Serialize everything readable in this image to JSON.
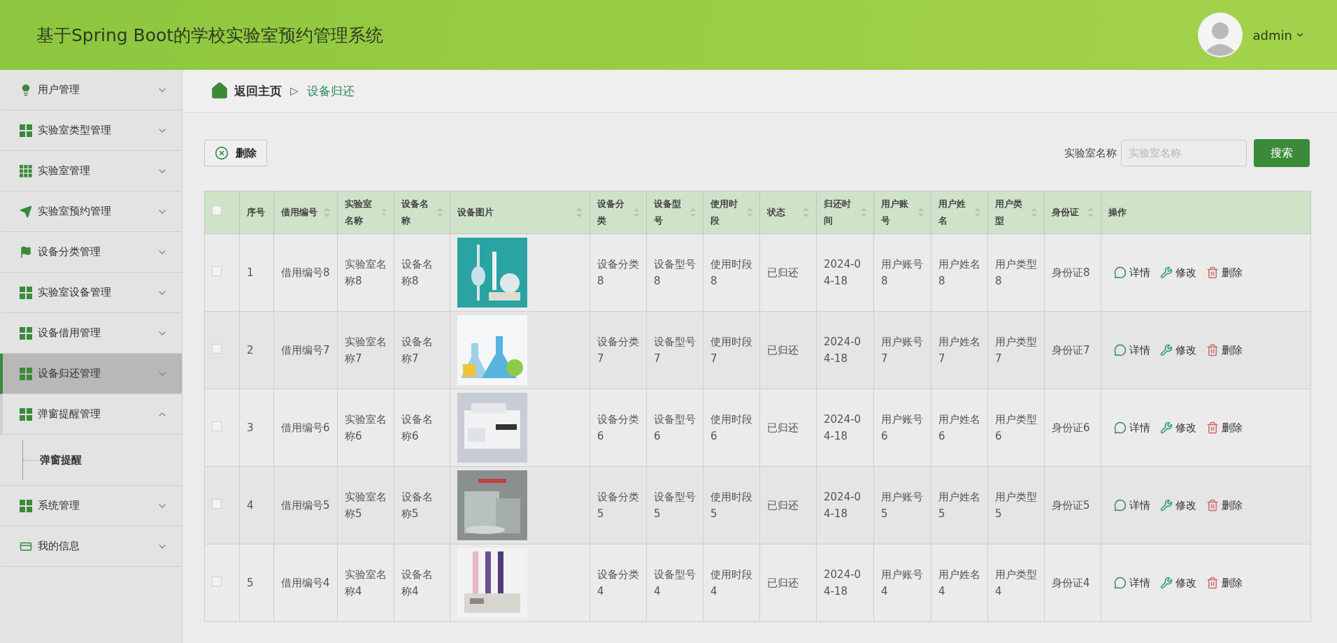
{
  "header": {
    "title": "基于Spring Boot的学校实验室预约管理系统",
    "user": "admin"
  },
  "sidebar": {
    "items": [
      {
        "label": "用户管理",
        "selected": false,
        "expanded": false
      },
      {
        "label": "实验室类型管理",
        "selected": false,
        "expanded": false
      },
      {
        "label": "实验室管理",
        "selected": false,
        "expanded": false
      },
      {
        "label": "实验室预约管理",
        "selected": false,
        "expanded": false
      },
      {
        "label": "设备分类管理",
        "selected": false,
        "expanded": false
      },
      {
        "label": "实验室设备管理",
        "selected": false,
        "expanded": false
      },
      {
        "label": "设备借用管理",
        "selected": false,
        "expanded": false
      },
      {
        "label": "设备归还管理",
        "selected": true,
        "expanded": false
      },
      {
        "label": "弹窗提醒管理",
        "selected": false,
        "expanded": true,
        "children": [
          {
            "label": "弹窗提醒",
            "selected": false
          }
        ]
      },
      {
        "label": "系统管理",
        "selected": false,
        "expanded": false
      },
      {
        "label": "我的信息",
        "selected": false,
        "expanded": false
      }
    ]
  },
  "breadcrumb": {
    "home": "返回主页",
    "separator": "▷",
    "current": "设备归还"
  },
  "toolbar": {
    "delete_button": "删除",
    "search_label": "实验室名称",
    "search_placeholder": "实验室名称",
    "search_button": "搜索"
  },
  "table": {
    "select_all": {
      "checked": false
    },
    "columns": [
      {
        "label": "序号",
        "sortable": false
      },
      {
        "label": "借用编号",
        "sortable": true
      },
      {
        "label": "实验室名称",
        "sortable": true
      },
      {
        "label": "设备名称",
        "sortable": true
      },
      {
        "label": "设备图片",
        "sortable": true
      },
      {
        "label": "设备分类",
        "sortable": true
      },
      {
        "label": "设备型号",
        "sortable": true
      },
      {
        "label": "使用时段",
        "sortable": true
      },
      {
        "label": "状态",
        "sortable": true
      },
      {
        "label": "归还时间",
        "sortable": true
      },
      {
        "label": "用户账号",
        "sortable": true
      },
      {
        "label": "用户姓名",
        "sortable": true
      },
      {
        "label": "用户类型",
        "sortable": true
      },
      {
        "label": "身份证",
        "sortable": true
      },
      {
        "label": "操作",
        "sortable": false
      }
    ],
    "rows": [
      {
        "checked": false,
        "cells": [
          "1",
          "借用编号8",
          "实验室名称8",
          "设备名称8",
          {
            "kind": "picture"
          },
          "设备分类8",
          "设备型号8",
          "使用时段8",
          "已归还",
          "2024-04-18",
          "用户账号8",
          "用户姓名8",
          "用户类型8",
          "身份证8"
        ],
        "actions": [
          "详情",
          "修改",
          "删除"
        ]
      },
      {
        "checked": false,
        "cells": [
          "2",
          "借用编号7",
          "实验室名称7",
          "设备名称7",
          {
            "kind": "picture"
          },
          "设备分类7",
          "设备型号7",
          "使用时段7",
          "已归还",
          "2024-04-18",
          "用户账号7",
          "用户姓名7",
          "用户类型7",
          "身份证7"
        ],
        "actions": [
          "详情",
          "修改",
          "删除"
        ]
      },
      {
        "checked": false,
        "cells": [
          "3",
          "借用编号6",
          "实验室名称6",
          "设备名称6",
          {
            "kind": "picture"
          },
          "设备分类6",
          "设备型号6",
          "使用时段6",
          "已归还",
          "2024-04-18",
          "用户账号6",
          "用户姓名6",
          "用户类型6",
          "身份证6"
        ],
        "actions": [
          "详情",
          "修改",
          "删除"
        ]
      },
      {
        "checked": false,
        "cells": [
          "4",
          "借用编号5",
          "实验室名称5",
          "设备名称5",
          {
            "kind": "picture"
          },
          "设备分类5",
          "设备型号5",
          "使用时段5",
          "已归还",
          "2024-04-18",
          "用户账号5",
          "用户姓名5",
          "用户类型5",
          "身份证5"
        ],
        "actions": [
          "详情",
          "修改",
          "删除"
        ]
      },
      {
        "checked": false,
        "cells": [
          "5",
          "借用编号4",
          "实验室名称4",
          "设备名称4",
          {
            "kind": "picture"
          },
          "设备分类4",
          "设备型号4",
          "使用时段4",
          "已归还",
          "2024-04-18",
          "用户账号4",
          "用户姓名4",
          "用户类型4",
          "身份证4"
        ],
        "actions": [
          "详情",
          "修改",
          "删除"
        ]
      }
    ]
  }
}
